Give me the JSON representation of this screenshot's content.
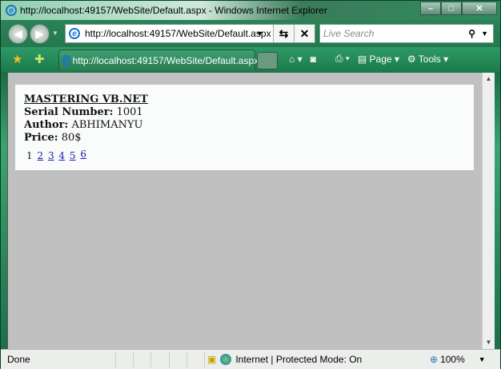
{
  "window": {
    "title": "http://localhost:49157/WebSite/Default.aspx - Windows Internet Explorer"
  },
  "nav": {
    "url": "http://localhost:49157/WebSite/Default.aspx",
    "search_placeholder": "Live Search"
  },
  "toolbar": {
    "tab_title": "http://localhost:49157/WebSite/Default.aspx",
    "page_label": "Page",
    "tools_label": "Tools"
  },
  "book": {
    "title": "MASTERING VB.NET",
    "serial_label": "Serial Number:",
    "serial": "1001",
    "author_label": "Author:",
    "author": "ABHIMANYU",
    "price_label": "Price:",
    "price": "80$"
  },
  "pager": {
    "current": "1",
    "pages": [
      "2",
      "3",
      "4",
      "5",
      "6"
    ]
  },
  "status": {
    "text": "Done",
    "zone": "Internet | Protected Mode: On",
    "zoom": "100%"
  }
}
